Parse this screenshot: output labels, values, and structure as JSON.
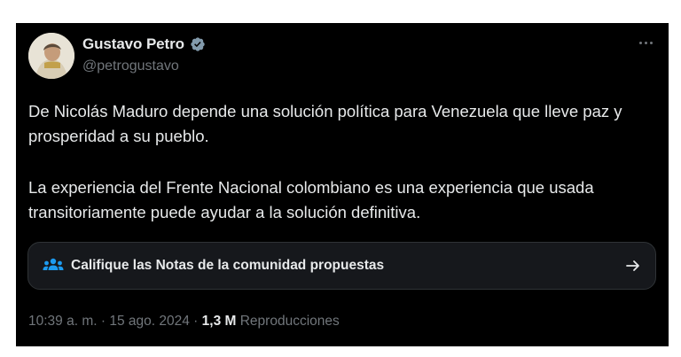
{
  "author": {
    "display_name": "Gustavo Petro",
    "handle": "@petrogustavo",
    "verified_icon": "verified-badge-icon"
  },
  "tweet": {
    "paragraphs": [
      "De Nicolás Maduro depende una solución política para Venezuela que lleve paz y prosperidad a su pueblo.",
      "La experiencia del Frente Nacional colombiano es una experiencia que usada transitoriamente puede ayudar a la solución definitiva."
    ]
  },
  "community_notes": {
    "label": "Califique las Notas de la comunidad propuestas",
    "icon": "people-icon"
  },
  "meta": {
    "time": "10:39 a. m.",
    "separator": "·",
    "date": "15 ago. 2024",
    "views_count": "1,3 M",
    "views_label": "Reproducciones"
  },
  "colors": {
    "background": "#000000",
    "text_primary": "#e7e9ea",
    "text_secondary": "#71767b",
    "verified": "#829aab",
    "notes_icon": "#1d9bf0"
  }
}
